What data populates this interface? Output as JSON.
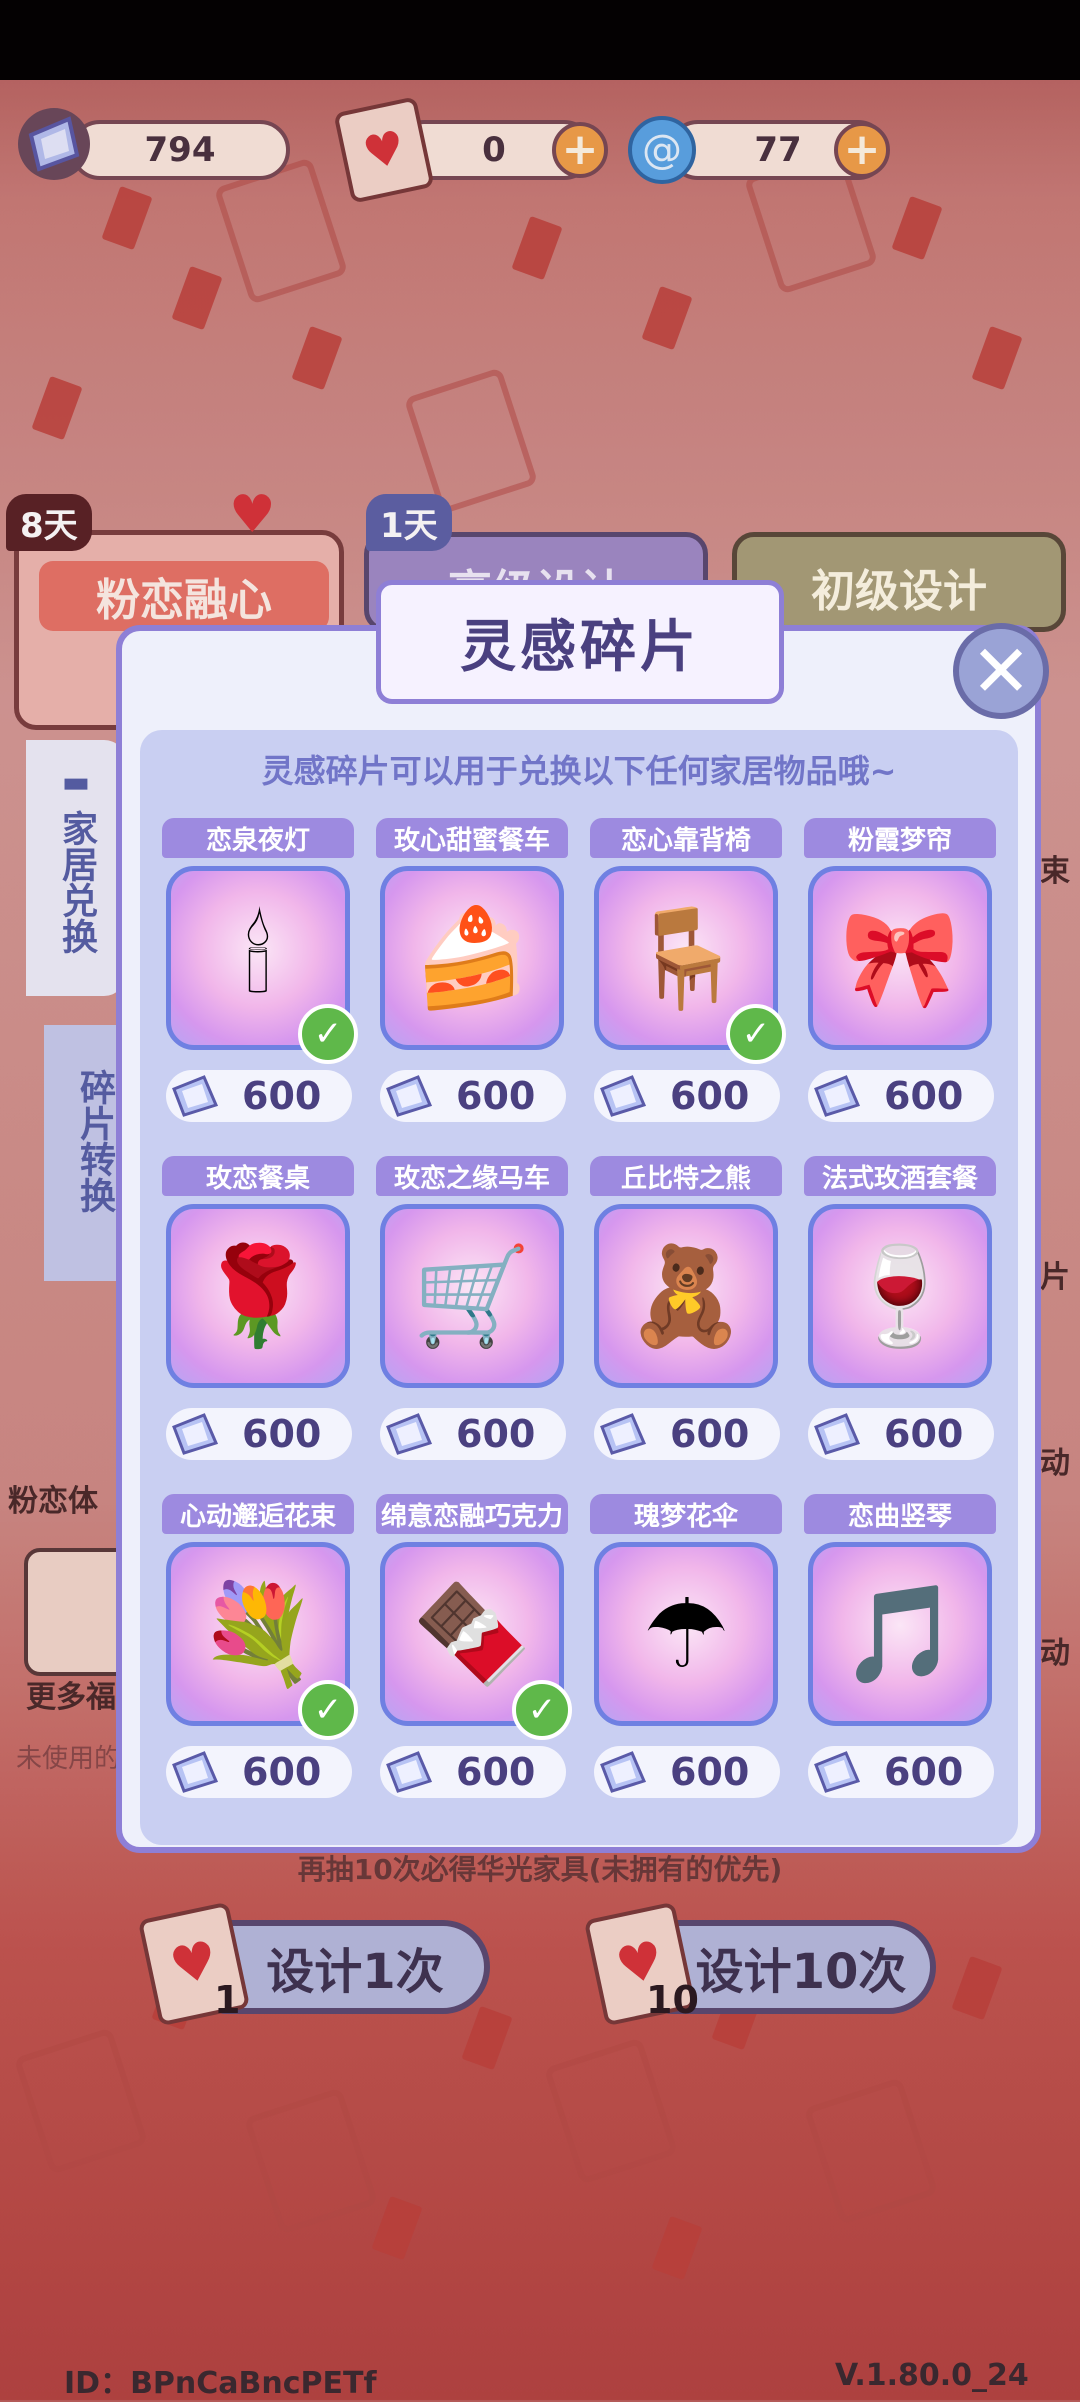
{
  "currencies": [
    {
      "name": "fragment",
      "icon": "crystal-fragment-icon",
      "value": "794"
    },
    {
      "name": "heart-ticket",
      "icon": "heart-ticket-icon",
      "value": "0",
      "add": "+"
    },
    {
      "name": "swirl",
      "icon": "blue-swirl-icon",
      "value": "77",
      "add": "+"
    }
  ],
  "event_tabs": [
    {
      "badge": "8天",
      "label": "粉恋融心"
    },
    {
      "badge": "1天",
      "label": "高级设计"
    },
    {
      "label": "初级设计"
    }
  ],
  "side_tabs": [
    {
      "label": "家居兑换"
    },
    {
      "label": "碎片转换"
    }
  ],
  "left_partial": {
    "item1": "粉恋体",
    "item2": "更多福",
    "item3": "未使用的"
  },
  "right_partial": {
    "a": "片",
    "b": "动",
    "c": "动",
    "d": "束"
  },
  "modal": {
    "title": "灵感碎片",
    "subtitle": "灵感碎片可以用于兑换以下任何家居物品哦~",
    "close": "✕",
    "items": [
      {
        "name": "恋泉夜灯",
        "cost": "600",
        "owned": true,
        "icon": "night-lamp-icon",
        "glyph": "🕯"
      },
      {
        "name": "玫心甜蜜餐车",
        "cost": "600",
        "owned": false,
        "icon": "dessert-cart-icon",
        "glyph": "🍰"
      },
      {
        "name": "恋心靠背椅",
        "cost": "600",
        "owned": true,
        "icon": "heart-chair-icon",
        "glyph": "🪑"
      },
      {
        "name": "粉霞梦帘",
        "cost": "600",
        "owned": false,
        "icon": "curtain-icon",
        "glyph": "🎀"
      },
      {
        "name": "玫恋餐桌",
        "cost": "600",
        "owned": false,
        "icon": "dining-table-icon",
        "glyph": "🌹"
      },
      {
        "name": "玫恋之缘马车",
        "cost": "600",
        "owned": false,
        "icon": "carriage-icon",
        "glyph": "🛒"
      },
      {
        "name": "丘比特之熊",
        "cost": "600",
        "owned": false,
        "icon": "cupid-bear-icon",
        "glyph": "🧸"
      },
      {
        "name": "法式玫酒套餐",
        "cost": "600",
        "owned": false,
        "icon": "wine-set-icon",
        "glyph": "🍷"
      },
      {
        "name": "心动邂逅花束",
        "cost": "600",
        "owned": true,
        "icon": "bouquet-icon",
        "glyph": "💐"
      },
      {
        "name": "绵意恋融巧克力",
        "cost": "600",
        "owned": true,
        "icon": "chocolate-box-icon",
        "glyph": "🍫"
      },
      {
        "name": "瑰梦花伞",
        "cost": "600",
        "owned": false,
        "icon": "umbrella-icon",
        "glyph": "☂"
      },
      {
        "name": "恋曲竖琴",
        "cost": "600",
        "owned": false,
        "icon": "harp-icon",
        "glyph": "🎵"
      }
    ]
  },
  "pity_note": "再抽10次必得华光家具(未拥有的优先)",
  "draw_buttons": [
    {
      "label": "设计1次",
      "count": "1"
    },
    {
      "label": "设计10次",
      "count": "10"
    }
  ],
  "footer": {
    "id": "ID：BPnCaBncPETf",
    "version": "V.1.80.0_24"
  },
  "colors": {
    "accent": "#8e7fd6",
    "name_bar": "#9d8ae0",
    "check": "#5fb84a",
    "plus": "#f2a14a"
  }
}
